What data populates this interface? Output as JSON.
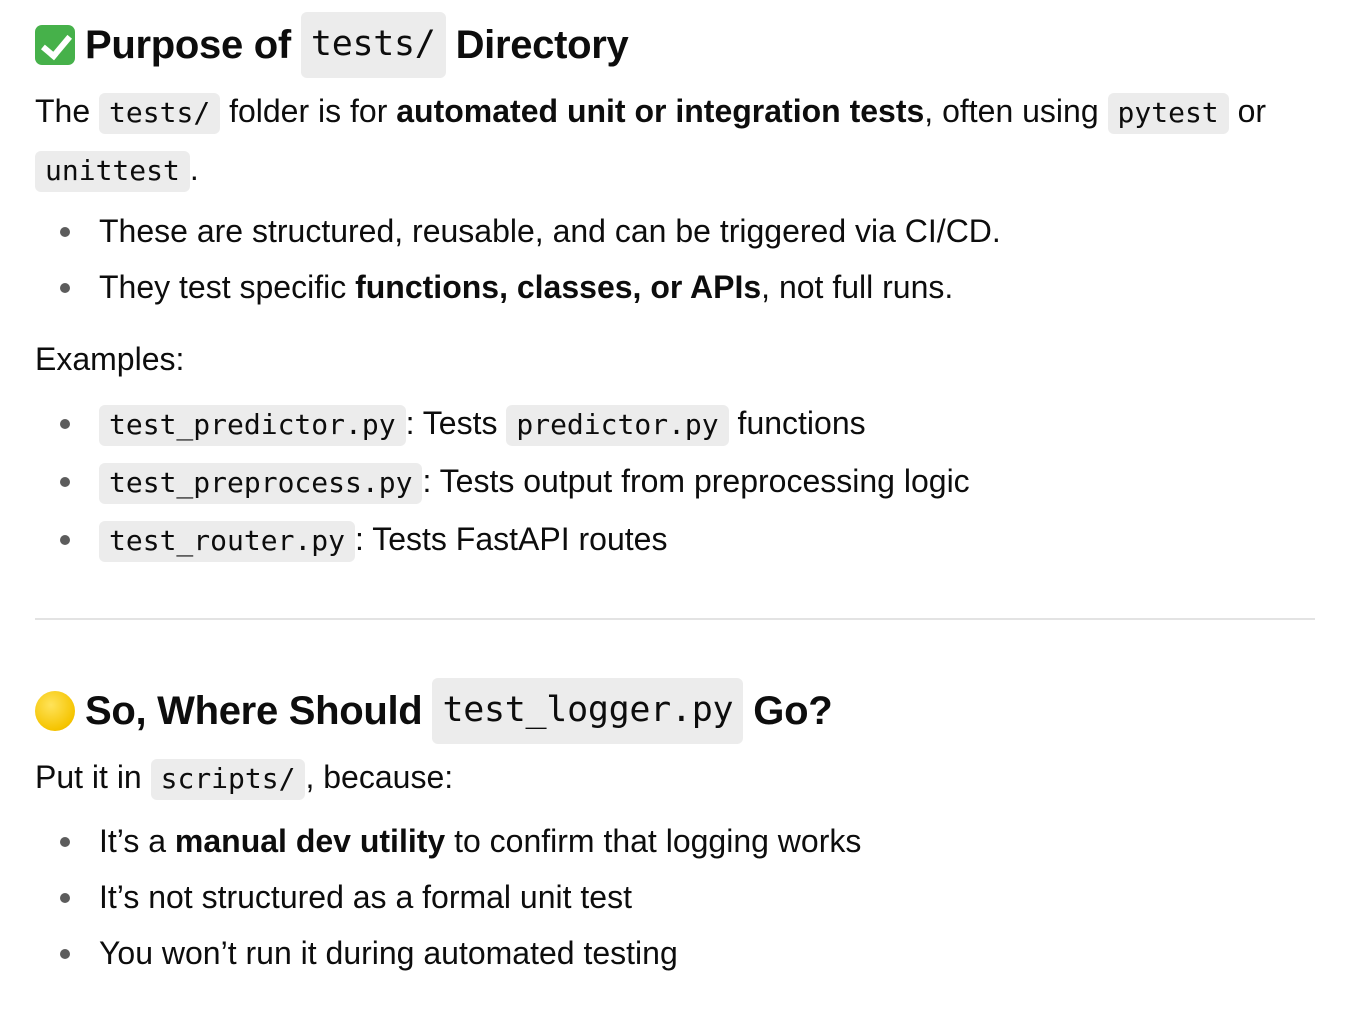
{
  "section1": {
    "heading_pre": "Purpose of",
    "heading_code": "tests/",
    "heading_post": "Directory",
    "emoji": "check-mark-button-emoji",
    "intro": {
      "t1": "The",
      "code1": "tests/",
      "t2": "folder is for",
      "bold": "automated unit or integration tests",
      "t3": ", often using",
      "code2": "pytest",
      "t4": "or",
      "code3": "unittest",
      "t5": "."
    },
    "bullets": [
      {
        "text": "These are structured, reusable, and can be triggered via CI/CD."
      },
      {
        "pre": "They test specific",
        "bold": "functions, classes, or APIs",
        "post": ", not full runs."
      }
    ],
    "examples_label": "Examples:",
    "examples": [
      {
        "code": "test_predictor.py",
        "text": ": Tests",
        "code2": "predictor.py",
        "text2": "functions"
      },
      {
        "code": "test_preprocess.py",
        "text": ": Tests output from preprocessing logic"
      },
      {
        "code": "test_router.py",
        "text": ": Tests FastAPI routes"
      }
    ]
  },
  "section2": {
    "heading_pre": "So, Where Should",
    "heading_code": "test_logger.py",
    "heading_post": "Go?",
    "emoji": "yellow-circle-emoji",
    "intro": {
      "t1": "Put it in",
      "code": "scripts/",
      "t2": ", because:"
    },
    "bullets": [
      {
        "pre": "It’s a",
        "bold": "manual dev utility",
        "post": "to confirm that logging works"
      },
      {
        "text": "It’s not structured as a formal unit test"
      },
      {
        "text": "You won’t run it during automated testing"
      }
    ]
  },
  "colors": {
    "text": "#0d0d0d",
    "code_bg": "#ececec",
    "divider": "#e3e3e3",
    "check_green": "#46b14a",
    "circle_yellow": "#f5c400"
  }
}
